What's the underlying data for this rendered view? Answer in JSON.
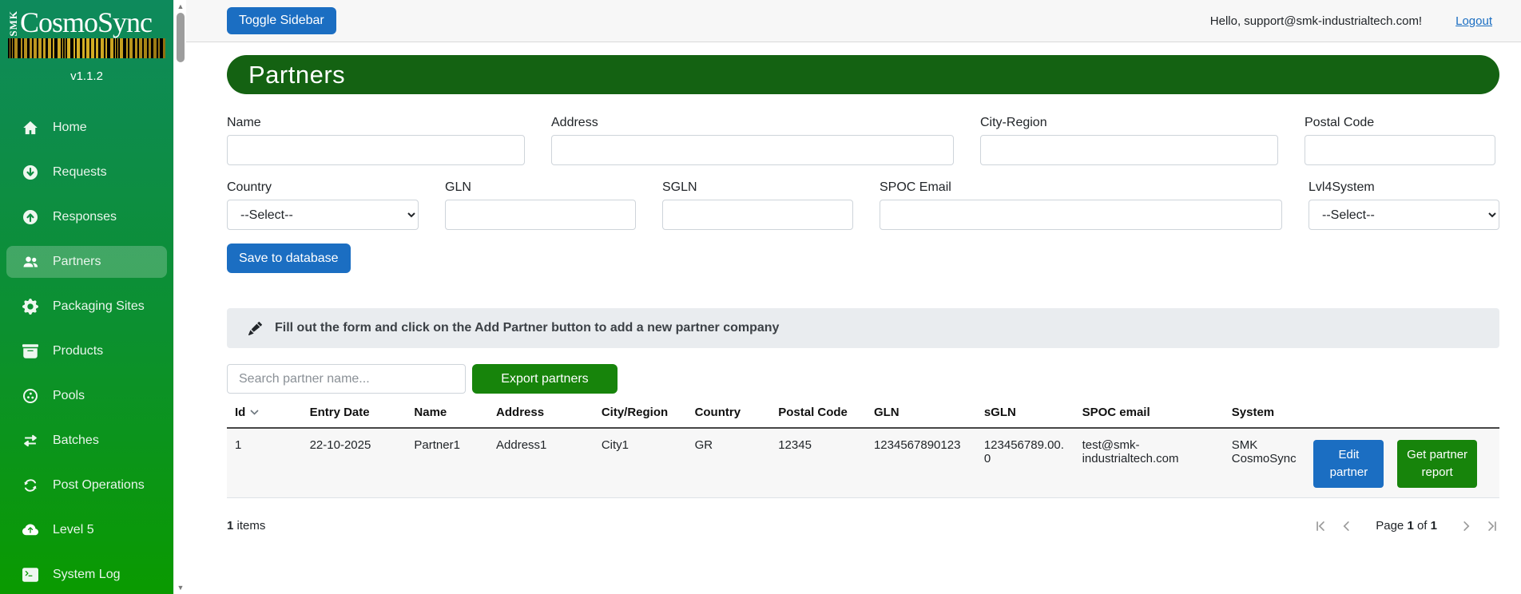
{
  "app": {
    "logo_smk": "SMK",
    "logo_name": "CosmoSync",
    "version": "v1.1.2"
  },
  "topbar": {
    "toggle_label": "Toggle Sidebar",
    "greeting": "Hello, support@smk-industrialtech.com!",
    "logout_label": "Logout"
  },
  "sidebar": {
    "items": [
      {
        "label": "Home",
        "icon": "home-icon",
        "active": false
      },
      {
        "label": "Requests",
        "icon": "arrow-down-circle-icon",
        "active": false
      },
      {
        "label": "Responses",
        "icon": "arrow-up-circle-icon",
        "active": false
      },
      {
        "label": "Partners",
        "icon": "people-icon",
        "active": true
      },
      {
        "label": "Packaging Sites",
        "icon": "gear-icon",
        "active": false
      },
      {
        "label": "Products",
        "icon": "box-icon",
        "active": false
      },
      {
        "label": "Pools",
        "icon": "pool-circle-icon",
        "active": false
      },
      {
        "label": "Batches",
        "icon": "left-right-arrows-icon",
        "active": false
      },
      {
        "label": "Post Operations",
        "icon": "repeat-icon",
        "active": false
      },
      {
        "label": "Level 5",
        "icon": "cloud-upload-icon",
        "active": false
      },
      {
        "label": "System Log",
        "icon": "terminal-icon",
        "active": false
      }
    ]
  },
  "page": {
    "title": "Partners"
  },
  "form": {
    "labels": {
      "name": "Name",
      "address": "Address",
      "city_region": "City-Region",
      "postal_code": "Postal Code",
      "country": "Country",
      "gln": "GLN",
      "sgln": "SGLN",
      "spoc_email": "SPOC Email",
      "lvl4system": "Lvl4System"
    },
    "select_placeholder": "--Select--",
    "save_label": "Save to database"
  },
  "info_bar": {
    "text": "Fill out the form and click on the Add Partner button to add a new partner company"
  },
  "toolbar": {
    "search_placeholder": "Search partner name...",
    "export_label": "Export partners"
  },
  "table": {
    "columns": [
      "Id",
      "Entry Date",
      "Name",
      "Address",
      "City/Region",
      "Country",
      "Postal Code",
      "GLN",
      "sGLN",
      "SPOC email",
      "System"
    ],
    "rows": [
      {
        "id": "1",
        "entry_date": "22-10-2025",
        "name": "Partner1",
        "address": "Address1",
        "city_region": "City1",
        "country": "GR",
        "postal_code": "12345",
        "gln": "1234567890123",
        "sgln": "123456789.00.0",
        "spoc_email": "test@smk-industrialtech.com",
        "system": "SMK CosmoSync",
        "edit_label": "Edit partner",
        "report_label": "Get partner report"
      }
    ]
  },
  "footer": {
    "count": "1",
    "count_label": " items",
    "page_word": "Page",
    "page_num": "1",
    "of_word": "of",
    "page_total": "1"
  },
  "colors": {
    "accent_blue": "#1b6ec2",
    "banner_green": "#146212",
    "button_green": "#17840b",
    "sidebar_green_top": "#0e8a5c",
    "sidebar_green_bottom": "#0a9a00"
  }
}
